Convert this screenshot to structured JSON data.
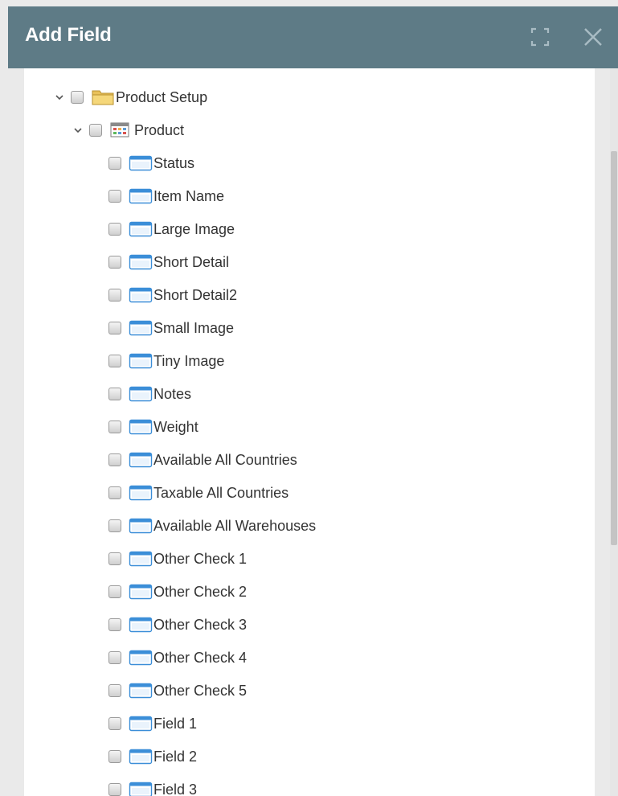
{
  "dialog": {
    "title": "Add Field"
  },
  "tree": {
    "root": {
      "label": "Product Setup",
      "icon": "folder-icon"
    },
    "table": {
      "label": "Product",
      "icon": "table-icon"
    },
    "fields": [
      "Status",
      "Item Name",
      "Large Image",
      "Short Detail",
      "Short Detail2",
      "Small Image",
      "Tiny Image",
      "Notes",
      "Weight",
      "Available All Countries",
      "Taxable All Countries",
      "Available All Warehouses",
      "Other Check 1",
      "Other Check 2",
      "Other Check 3",
      "Other Check 4",
      "Other Check 5",
      "Field 1",
      "Field 2",
      "Field 3"
    ]
  },
  "colors": {
    "header": "#5e7b86",
    "field_icon": "#3b8ed8"
  }
}
